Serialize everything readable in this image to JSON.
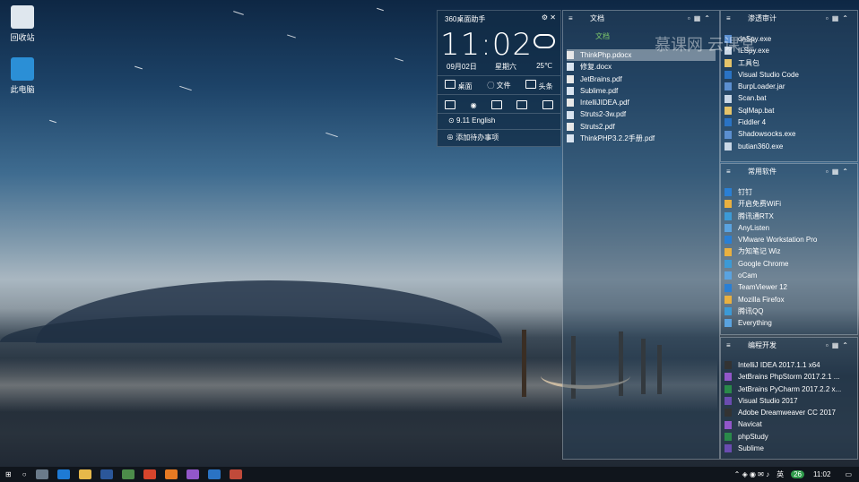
{
  "desktop_icons": [
    {
      "label": "回收站"
    },
    {
      "label": "此电脑"
    }
  ],
  "widget": {
    "title": "360桌面助手",
    "time": "11:02",
    "date": "09月02日",
    "weekday": "星期六",
    "temperature": "25℃",
    "actions": [
      "桌面",
      "文件",
      "头条"
    ],
    "version": "9.11 English",
    "todo": "添加待办事项"
  },
  "fence_docs": {
    "title": "文档",
    "tab": "文档",
    "items": [
      "ThinkPhp.pdocx",
      "修复.docx",
      "JetBrains.pdf",
      "Sublime.pdf",
      "IntelliJIDEA.pdf",
      "Struts2-3w.pdf",
      "Struts2.pdf",
      "ThinkPHP3.2.2手册.pdf"
    ],
    "selected_index": 0
  },
  "fence_pentest": {
    "title": "渗透审计",
    "items": [
      "dnSpy.exe",
      "ILSpy.exe",
      "工具包",
      "Visual Studio Code",
      "BurpLoader.jar",
      "Scan.bat",
      "SqlMap.bat",
      "Fiddler 4",
      "Shadowsocks.exe",
      "butian360.exe"
    ]
  },
  "fence_common": {
    "title": "常用软件",
    "items": [
      "钉钉",
      "开启免费WiFi",
      "腾讯通RTX",
      "AnyListen",
      "VMware Workstation Pro",
      "为知笔记 Wiz",
      "Google Chrome",
      "oCam",
      "TeamViewer 12",
      "Mozilla Firefox",
      "腾讯QQ",
      "Everything"
    ]
  },
  "fence_dev": {
    "title": "编程开发",
    "items": [
      "IntelliJ IDEA 2017.1.1 x64",
      "JetBrains PhpStorm 2017.2.1 ...",
      "JetBrains PyCharm 2017.2.2 x...",
      "Visual Studio 2017",
      "Adobe Dreamweaver CC 2017",
      "Navicat",
      "phpStudy",
      "Sublime"
    ]
  },
  "watermark": {
    "text": "慕课网 云课堂"
  },
  "taskbar": {
    "time": "11:02",
    "lang": "英",
    "badge": "26"
  }
}
